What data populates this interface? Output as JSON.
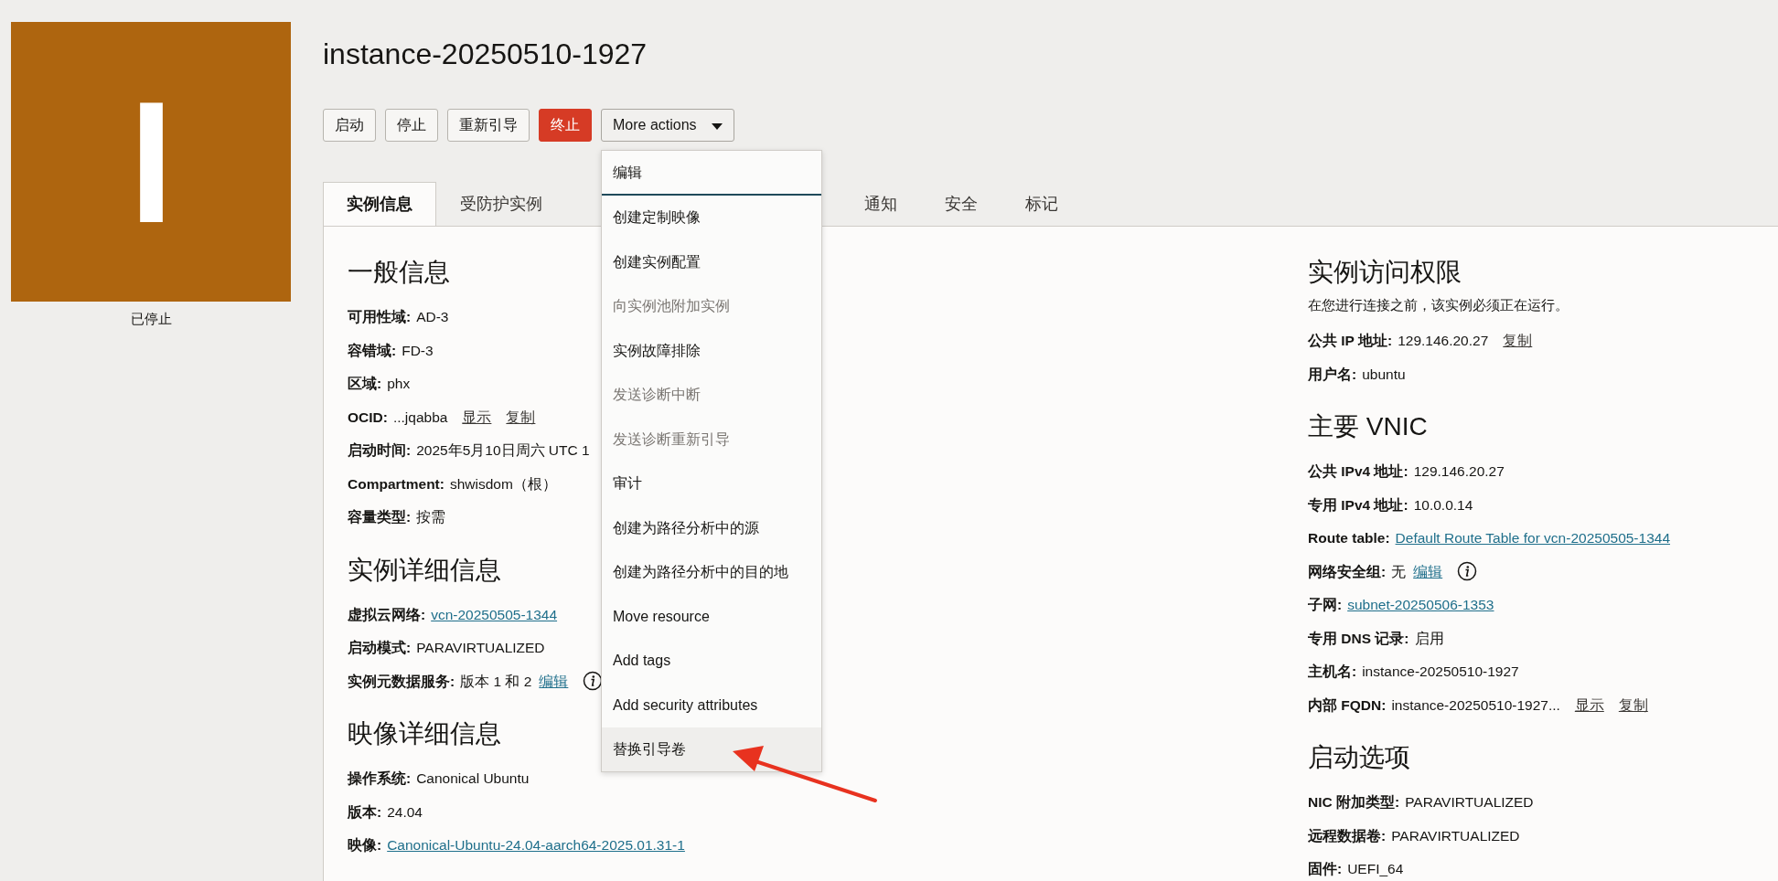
{
  "avatar": {
    "letter": "I",
    "status": "已停止"
  },
  "title": "instance-20250510-1927",
  "actions": [
    {
      "label": "启动",
      "kind": "default"
    },
    {
      "label": "停止",
      "kind": "default"
    },
    {
      "label": "重新引导",
      "kind": "default"
    },
    {
      "label": "终止",
      "kind": "danger"
    },
    {
      "label": "More actions",
      "kind": "dropdown",
      "expanded": true
    }
  ],
  "menu": [
    {
      "label": "编辑",
      "disabled": false,
      "focused": true,
      "selected": false
    },
    {
      "label": "创建定制映像",
      "disabled": false,
      "focused": false,
      "selected": false
    },
    {
      "label": "创建实例配置",
      "disabled": false,
      "focused": false,
      "selected": false
    },
    {
      "label": "向实例池附加实例",
      "disabled": true,
      "focused": false,
      "selected": false
    },
    {
      "label": "实例故障排除",
      "disabled": false,
      "focused": false,
      "selected": false
    },
    {
      "label": "发送诊断中断",
      "disabled": true,
      "focused": false,
      "selected": false
    },
    {
      "label": "发送诊断重新引导",
      "disabled": true,
      "focused": false,
      "selected": false
    },
    {
      "label": "审计",
      "disabled": false,
      "focused": false,
      "selected": false
    },
    {
      "label": "创建为路径分析中的源",
      "disabled": false,
      "focused": false,
      "selected": false
    },
    {
      "label": "创建为路径分析中的目的地",
      "disabled": false,
      "focused": false,
      "selected": false
    },
    {
      "label": "Move resource",
      "disabled": false,
      "focused": false,
      "selected": false
    },
    {
      "label": "Add tags",
      "disabled": false,
      "focused": false,
      "selected": false
    },
    {
      "label": "Add security attributes",
      "disabled": false,
      "focused": false,
      "selected": false
    },
    {
      "label": "替换引导卷",
      "disabled": false,
      "focused": false,
      "selected": true
    }
  ],
  "tabs": [
    {
      "label": "实例信息",
      "selected": true
    },
    {
      "label": "受防护实例",
      "selected": false
    },
    {
      "label": "通知",
      "selected": false
    },
    {
      "label": "安全",
      "selected": false
    },
    {
      "label": "标记",
      "selected": false
    }
  ],
  "left_sections": [
    {
      "heading": "一般信息",
      "rows": [
        {
          "label": "可用性域:",
          "value": "AD-3"
        },
        {
          "label": "容错域:",
          "value": "FD-3"
        },
        {
          "label": "区域:",
          "value": "phx"
        },
        {
          "label": "OCID:",
          "value": "...jqabba",
          "links": [
            {
              "text": "显示",
              "kind": "action"
            },
            {
              "text": "复制",
              "kind": "action"
            }
          ]
        },
        {
          "label": "启动时间:",
          "value": "2025年5月10日周六 UTC 1"
        },
        {
          "label": "Compartment:",
          "value": "shwisdom（根）"
        },
        {
          "label": "容量类型:",
          "value": "按需"
        }
      ]
    },
    {
      "heading": "实例详细信息",
      "rows": [
        {
          "label": "虚拟云网络:",
          "links": [
            {
              "text": "vcn-20250505-1344",
              "kind": "link"
            }
          ]
        },
        {
          "label": "启动模式:",
          "value": "PARAVIRTUALIZED"
        },
        {
          "label": "实例元数据服务:",
          "value": "版本 1 和 2",
          "links": [
            {
              "text": "编辑",
              "kind": "link"
            }
          ],
          "info": true
        }
      ]
    },
    {
      "heading": "映像详细信息",
      "rows": [
        {
          "label": "操作系统:",
          "value": "Canonical Ubuntu"
        },
        {
          "label": "版本:",
          "value": "24.04"
        },
        {
          "label": "映像:",
          "links": [
            {
              "text": "Canonical-Ubuntu-24.04-aarch64-2025.01.31-1",
              "kind": "link"
            }
          ]
        }
      ]
    }
  ],
  "right_sections": [
    {
      "heading": "实例访问权限",
      "note": "在您进行连接之前，该实例必须正在运行。",
      "rows": [
        {
          "label": "公共 IP 地址:",
          "value": "129.146.20.27",
          "links": [
            {
              "text": "复制",
              "kind": "action"
            }
          ]
        },
        {
          "label": "用户名:",
          "value": "ubuntu"
        }
      ]
    },
    {
      "heading": "主要 VNIC",
      "rows": [
        {
          "label": "公共 IPv4 地址:",
          "value": "129.146.20.27"
        },
        {
          "label": "专用 IPv4 地址:",
          "value": "10.0.0.14"
        },
        {
          "label": "Route table:",
          "links": [
            {
              "text": "Default Route Table for vcn-20250505-1344",
              "kind": "link"
            }
          ]
        },
        {
          "label": "网络安全组:",
          "value": "无",
          "links": [
            {
              "text": "编辑",
              "kind": "link"
            }
          ],
          "info": true
        },
        {
          "label": "子网:",
          "links": [
            {
              "text": "subnet-20250506-1353",
              "kind": "link"
            }
          ]
        },
        {
          "label": "专用 DNS 记录:",
          "value": "启用"
        },
        {
          "label": "主机名:",
          "value": "instance-20250510-1927"
        },
        {
          "label": "内部 FQDN:",
          "value": "instance-20250510-1927...",
          "links": [
            {
              "text": "显示",
              "kind": "action"
            },
            {
              "text": "复制",
              "kind": "action"
            }
          ]
        }
      ]
    },
    {
      "heading": "启动选项",
      "rows": [
        {
          "label": "NIC 附加类型:",
          "value": "PARAVIRTUALIZED"
        },
        {
          "label": "远程数据卷:",
          "value": "PARAVIRTUALIZED"
        },
        {
          "label": "固件:",
          "value": "UEFI_64"
        }
      ]
    }
  ]
}
